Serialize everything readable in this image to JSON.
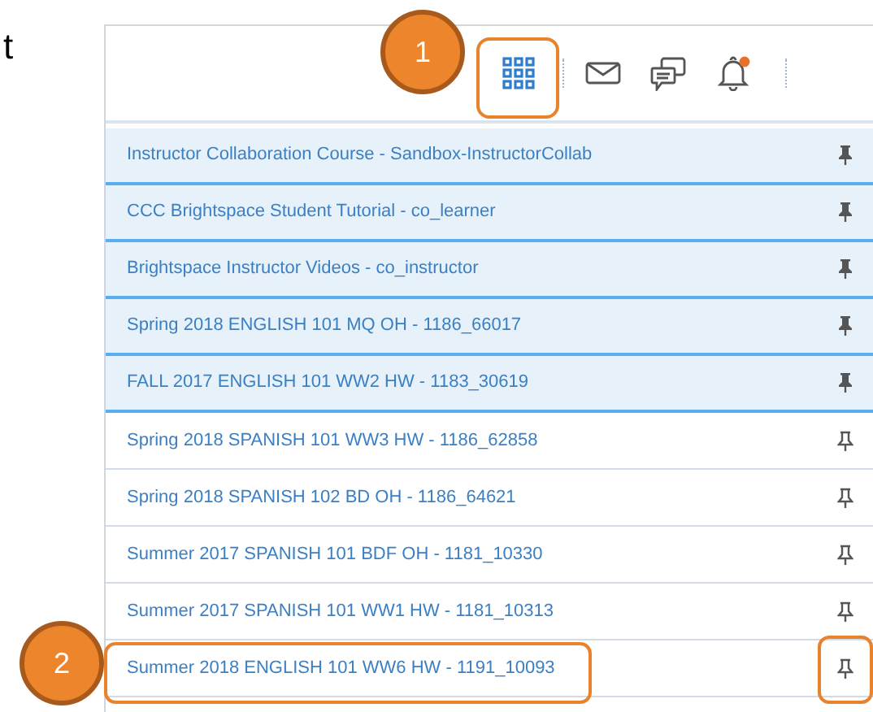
{
  "page_fragment": "t",
  "toolbar": {
    "notification_dot": true
  },
  "callouts": [
    {
      "number": "1"
    },
    {
      "number": "2"
    }
  ],
  "courses": [
    {
      "title": "Instructor Collaboration Course - Sandbox-InstructorCollab",
      "pinned": true
    },
    {
      "title": "CCC Brightspace Student Tutorial - co_learner",
      "pinned": true
    },
    {
      "title": "Brightspace Instructor Videos - co_instructor",
      "pinned": true
    },
    {
      "title": "Spring 2018 ENGLISH 101 MQ OH - 1186_66017",
      "pinned": true
    },
    {
      "title": "FALL 2017 ENGLISH 101 WW2 HW - 1183_30619",
      "pinned": true
    },
    {
      "title": "Spring 2018 SPANISH 101 WW3 HW - 1186_62858",
      "pinned": false
    },
    {
      "title": "Spring 2018 SPANISH 102 BD OH - 1186_64621",
      "pinned": false
    },
    {
      "title": "Summer 2017 SPANISH 101 BDF OH - 1181_10330",
      "pinned": false
    },
    {
      "title": "Summer 2017 SPANISH 101 WW1 HW - 1181_10313",
      "pinned": false
    },
    {
      "title": "Summer 2018 ENGLISH 101 WW6 HW - 1191_10093",
      "pinned": false
    }
  ]
}
